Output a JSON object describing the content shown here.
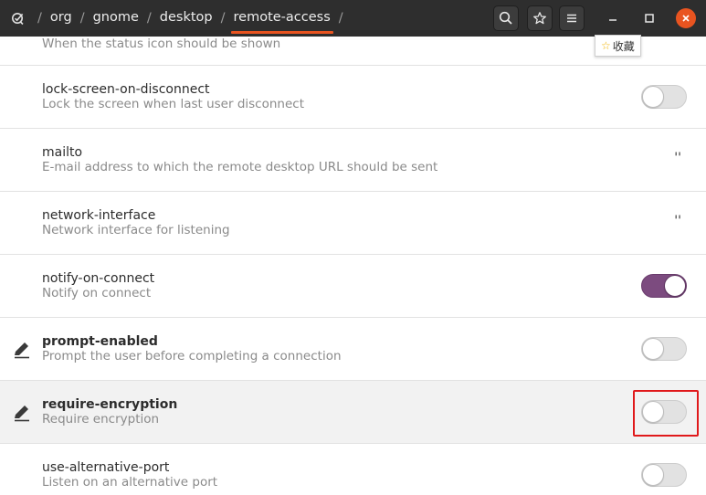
{
  "breadcrumbs": [
    "org",
    "gnome",
    "desktop",
    "remote-access"
  ],
  "tooltip": {
    "label": "收藏"
  },
  "rows": {
    "top_partial": {
      "desc": "When the status icon should be shown"
    },
    "lock": {
      "title": "lock-screen-on-disconnect",
      "desc": "Lock the screen when last user disconnect",
      "value": false
    },
    "mailto": {
      "title": "mailto",
      "desc": "E-mail address to which the remote desktop URL should be sent",
      "value": "''"
    },
    "network": {
      "title": "network-interface",
      "desc": "Network interface for listening",
      "value": "''"
    },
    "notify": {
      "title": "notify-on-connect",
      "desc": "Notify on connect",
      "value": true
    },
    "prompt": {
      "title": "prompt-enabled",
      "desc": "Prompt the user before completing a connection",
      "value": false
    },
    "require": {
      "title": "require-encryption",
      "desc": "Require encryption",
      "value": false
    },
    "altport": {
      "title": "use-alternative-port",
      "desc": "Listen on an alternative port",
      "value": false
    }
  },
  "colors": {
    "accent": "#e95420",
    "switch_on": "#7c4b7f",
    "highlight": "#e0191b"
  }
}
